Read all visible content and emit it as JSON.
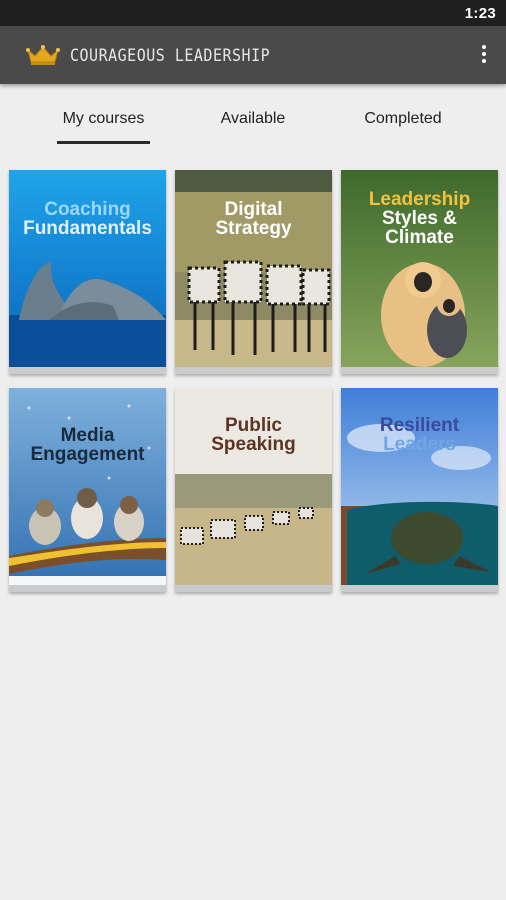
{
  "status_bar": {
    "time": "1:23"
  },
  "app_bar": {
    "title": "COURAGEOUS LEADERSHIP",
    "logo_icon": "crown-icon",
    "menu_icon": "more-vert-icon"
  },
  "tabs": [
    {
      "label": "My courses",
      "selected": true
    },
    {
      "label": "Available",
      "selected": false
    },
    {
      "label": "Completed",
      "selected": false
    }
  ],
  "courses": [
    {
      "line1": "Coaching",
      "line2": "Fundamentals",
      "image": "dolphins"
    },
    {
      "line1": "Digital",
      "line2": "Strategy",
      "image": "zebras"
    },
    {
      "line1": "Leadership",
      "line2": "Styles &",
      "line3": "Climate",
      "image": "monkeys"
    },
    {
      "line1": "Media",
      "line2": "Engagement",
      "image": "birds"
    },
    {
      "line1": "Public",
      "line2": "Speaking",
      "image": "zebra-herd"
    },
    {
      "line1": "Resilient",
      "line2": "Leaders",
      "image": "sea-turtle"
    }
  ],
  "colors": {
    "status_bar": "#1f1f1f",
    "app_bar": "#4a4a4a",
    "background": "#eeeeee",
    "accent_gold": "#e3a71e"
  }
}
